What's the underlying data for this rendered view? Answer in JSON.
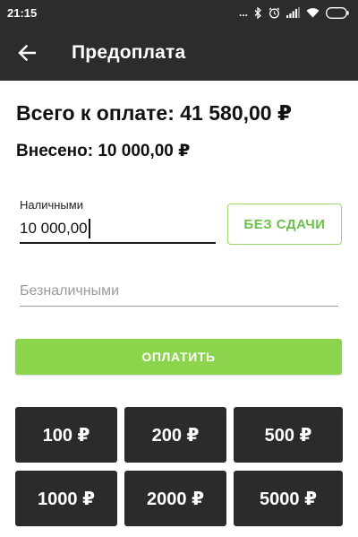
{
  "status_bar": {
    "time": "21:15",
    "dots": "...",
    "icons": [
      "bluetooth-icon",
      "alarm-icon",
      "signal-icon",
      "wifi-icon",
      "battery-icon"
    ]
  },
  "header": {
    "title": "Предоплата",
    "back_icon": "arrow-left-icon",
    "background": "#2c2c2c"
  },
  "summary": {
    "total": "Всего к оплате: 41 580,00 ₽",
    "paid": "Внесено: 10 000,00 ₽"
  },
  "cash": {
    "label": "Наличными",
    "value": "10 000,00"
  },
  "no_change_button": {
    "label": "БЕЗ СДАЧИ",
    "color": "#6cc04a"
  },
  "card": {
    "placeholder": "Безналичными",
    "value": ""
  },
  "pay_button": {
    "label": "ОПЛАТИТЬ",
    "color": "#8bd44c"
  },
  "quick_amounts": [
    {
      "label": "100 ₽"
    },
    {
      "label": "200 ₽"
    },
    {
      "label": "500 ₽"
    },
    {
      "label": "1000 ₽"
    },
    {
      "label": "2000 ₽"
    },
    {
      "label": "5000 ₽"
    }
  ]
}
